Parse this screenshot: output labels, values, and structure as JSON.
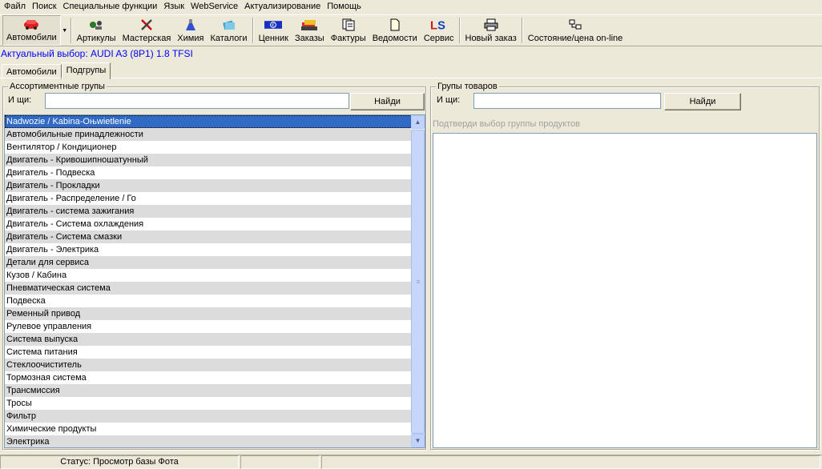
{
  "menu": [
    "Файл",
    "Поиск",
    "Специальные функции",
    "Язык",
    "WebService",
    "Актуализирование",
    "Помощь"
  ],
  "toolbar": {
    "cars": "Автомобили",
    "articles": "Артикулы",
    "workshop": "Мастерская",
    "chemistry": "Химия",
    "catalogs": "Каталоги",
    "price_list": "Ценник",
    "orders": "Заказы",
    "invoices": "Фактуры",
    "statements": "Ведомости",
    "service": "Сервис",
    "new_order": "Новый заказ",
    "status_price_online": "Состояние/цена on-line"
  },
  "current_selection": "Актуальный выбор: AUDI A3 (8P1) 1.8 TFSI",
  "tabs": [
    "Автомобили",
    "Подгрупы"
  ],
  "left_group": {
    "title": "Ассортиментные групы",
    "search_label": "И щи:",
    "search_value": "",
    "search_button": "Найди",
    "items": [
      "Nadwozie / Kabina-Oњwietlenie",
      "Автомобильные принадлежности",
      "Вентилятор / Кондиционер",
      "Двигатель - Кривошипношатунный",
      "Двигатель - Подвеска",
      "Двигатель - Прокладки",
      "Двигатель - Распределение / Го",
      "Двигатель - система зажигания",
      "Двигатель - Система охлаждения",
      "Двигатель - Система смазки",
      "Двигатель - Электрика",
      "Детали для сервиса",
      "Кузов / Кабина",
      "Пневматическая система",
      "Подвеска",
      "Ременный привод",
      "Рулевое управления",
      "Система выпуска",
      "Система питания",
      "Стеклоочиститель",
      "Тормозная система",
      "Трансмиссия",
      "Тросы",
      "Фильтр",
      "Химические продукты",
      "Электрика"
    ]
  },
  "right_group": {
    "title": "Групы товаров",
    "search_label": "И щи:",
    "search_value": "",
    "search_button": "Найди",
    "hint": "Подтверди выбор группы продуктов"
  },
  "status": {
    "text": "Статус: Просмотр базы Фота",
    "panel2": "",
    "panel3": ""
  },
  "colors": {
    "selection": "#316ac5",
    "alt_row": "#dcdcdc",
    "current_selection": "#0000ff"
  }
}
